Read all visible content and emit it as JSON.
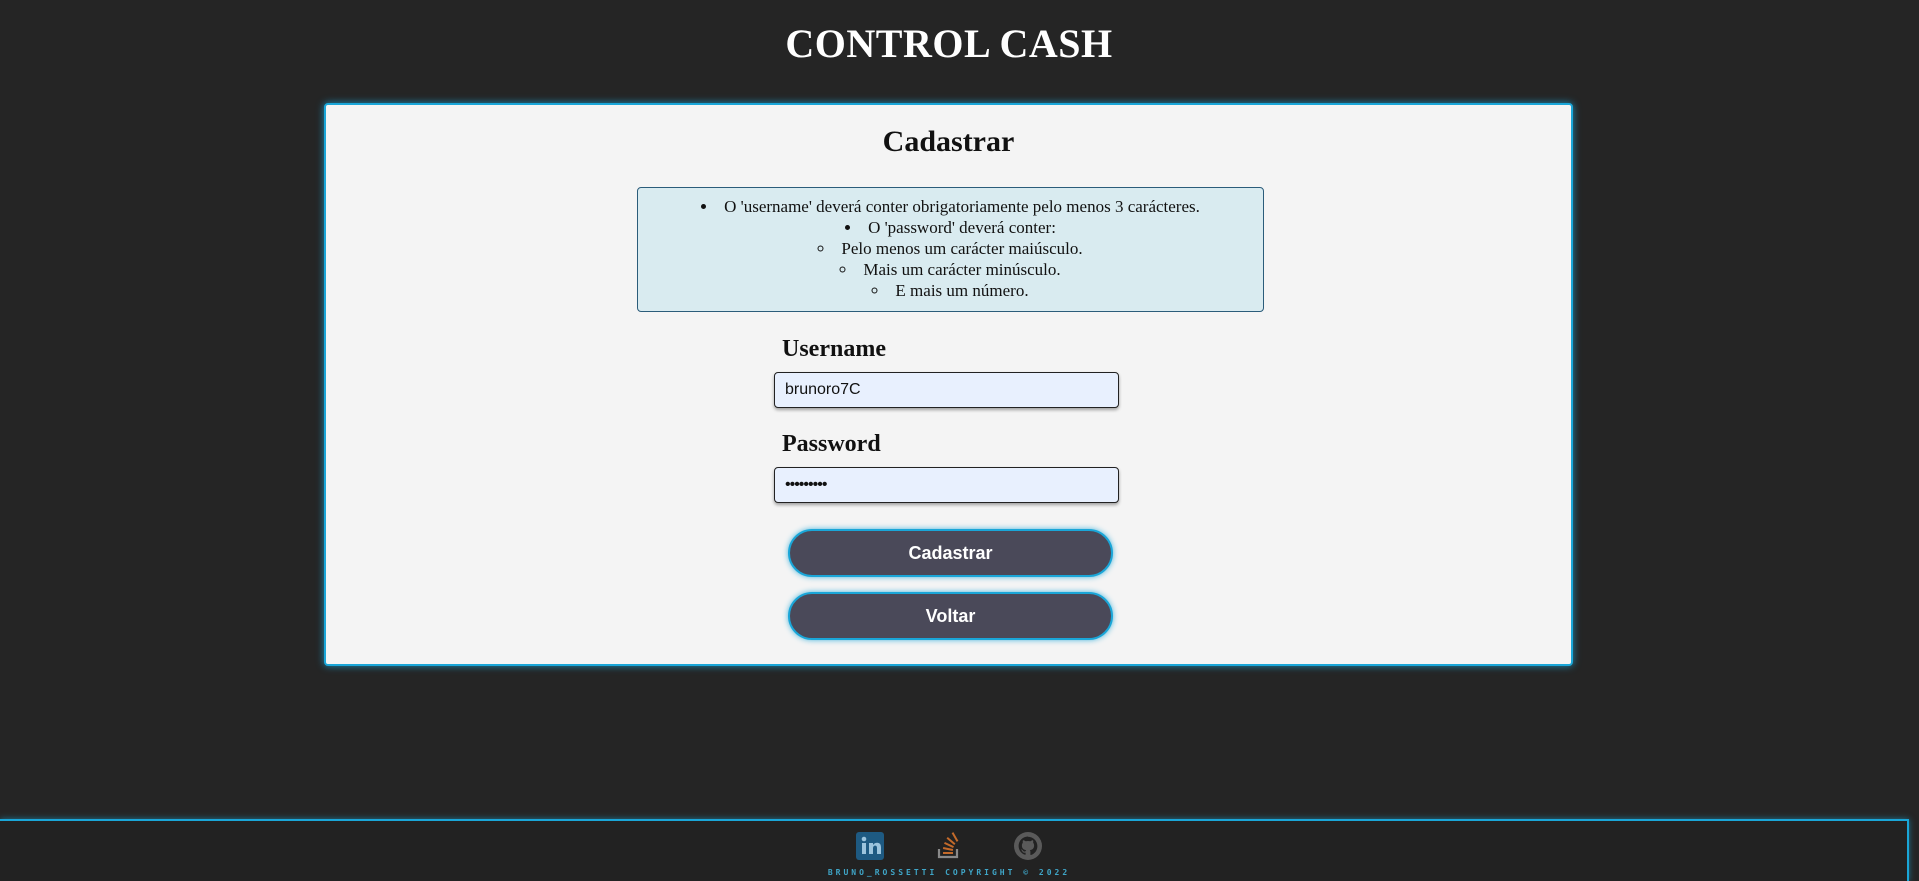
{
  "header": {
    "title": "CONTROL CASH"
  },
  "form": {
    "title": "Cadastrar",
    "rules": {
      "username_rule": "O 'username' deverá conter obrigatoriamente pelo menos 3 carácteres.",
      "password_rule": "O 'password' deverá conter:",
      "password_subrules": [
        "Pelo menos um carácter maiúsculo.",
        "Mais um carácter minúsculo.",
        "E mais um número."
      ]
    },
    "username": {
      "label": "Username",
      "value": "brunoro7C"
    },
    "password": {
      "label": "Password",
      "value": "•••••••••"
    },
    "submit_label": "Cadastrar",
    "back_label": "Voltar"
  },
  "footer": {
    "icons": [
      "linkedin-icon",
      "stackoverflow-icon",
      "github-icon"
    ],
    "copyright": "BRUNO_ROSSETTI COPYRIGHT © 2022"
  },
  "colors": {
    "background": "#252525",
    "accent": "#1aa6d8",
    "card": "#f4f4f4",
    "button": "#4a4959",
    "rules_box": "#d9ebf0"
  }
}
